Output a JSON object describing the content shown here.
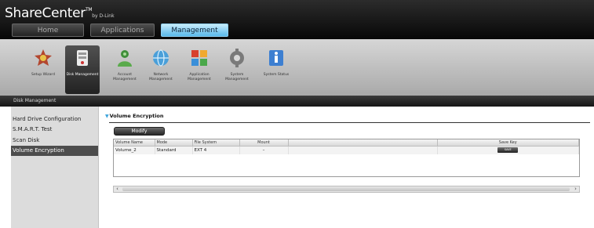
{
  "app": {
    "brand": "ShareCenter",
    "brand_tm": "TM",
    "brand_sub": "by D-Link"
  },
  "nav_tabs": [
    {
      "label": "Home"
    },
    {
      "label": "Applications"
    },
    {
      "label": "Management"
    }
  ],
  "toolbar": [
    {
      "label": "Setup Wizard"
    },
    {
      "label": "Disk Management"
    },
    {
      "label": "Account Management"
    },
    {
      "label": "Network Management"
    },
    {
      "label": "Application Management"
    },
    {
      "label": "System Management"
    },
    {
      "label": "System Status"
    }
  ],
  "section_title": "Disk Management",
  "sidebar": [
    {
      "label": "Hard Drive Configuration"
    },
    {
      "label": "S.M.A.R.T. Test"
    },
    {
      "label": "Scan Disk"
    },
    {
      "label": "Volume Encryption"
    }
  ],
  "panel": {
    "title": "Volume Encryption",
    "modify_label": "Modify"
  },
  "grid": {
    "columns": [
      "Volume Name",
      "Mode",
      "File System",
      "Mount",
      "",
      "Save Key"
    ],
    "rows": [
      {
        "volume": "Volume_2",
        "mode": "Standard",
        "fs": "EXT 4",
        "mount": "–",
        "blank": "",
        "save": "SAVE"
      }
    ]
  },
  "scroll": {
    "left_glyph": "‹",
    "right_glyph": "›"
  },
  "colors": {
    "header": "#0a0a0a",
    "active_tab": "#58b8ea",
    "toolbar": "#bcbcbc",
    "sidebar": "#dcdcdc",
    "sidebar_active": "#4d4d4d",
    "accent_arrow": "#3aa3dc"
  }
}
